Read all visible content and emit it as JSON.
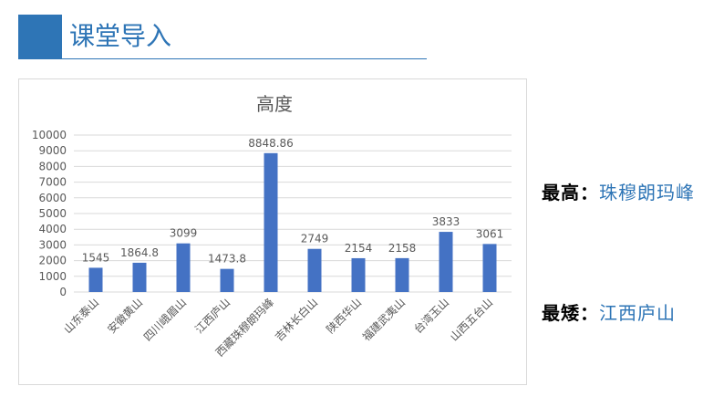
{
  "header": {
    "title": "课堂导入"
  },
  "notes": {
    "highest": {
      "label": "最高",
      "colon": "：",
      "value": "珠穆朗玛峰"
    },
    "lowest": {
      "label": "最矮",
      "colon": "：",
      "value": "江西庐山"
    }
  },
  "colors": {
    "accent": "#2e75b6",
    "bar": "#4472c4",
    "grid": "#d9d9d9",
    "axis_text": "#595959"
  },
  "chart_data": {
    "type": "bar",
    "title": "高度",
    "xlabel": "",
    "ylabel": "",
    "ylim": [
      0,
      10000
    ],
    "yticks": [
      0,
      1000,
      2000,
      3000,
      4000,
      5000,
      6000,
      7000,
      8000,
      9000,
      10000
    ],
    "grid": true,
    "legend": "none",
    "categories": [
      "山东泰山",
      "安徽黄山",
      "四川峨眉山",
      "江西庐山",
      "西藏珠穆朗玛峰",
      "吉林长白山",
      "陕西华山",
      "福建武夷山",
      "台湾玉山",
      "山西五台山"
    ],
    "values": [
      1545,
      1864.8,
      3099,
      1473.8,
      8848.86,
      2749,
      2154,
      2158,
      3833,
      3061
    ],
    "data_labels": [
      "1545",
      "1864.8",
      "3099",
      "1473.8",
      "8848.86",
      "2749",
      "2154",
      "2158",
      "3833",
      "3061"
    ]
  }
}
